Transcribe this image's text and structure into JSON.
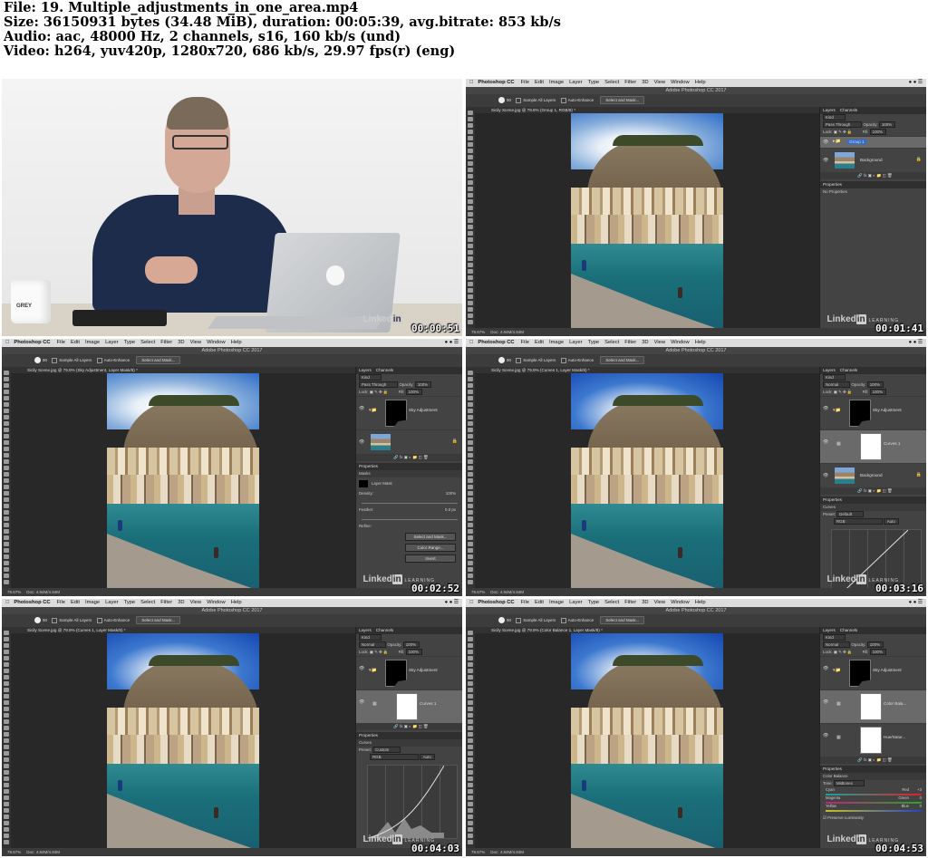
{
  "header": {
    "lines": [
      "File: 19. Multiple_adjustments_in_one_area.mp4",
      "Size: 36150931 bytes (34.48 MiB), duration: 00:05:39, avg.bitrate: 853 kb/s",
      "Audio: aac, 48000 Hz, 2 channels, s16, 160 kb/s (und)",
      "Video: h264, yuv420p, 1280x720, 686 kb/s, 29.97 fps(r) (eng)"
    ]
  },
  "watermark": {
    "brand": "Linked",
    "badge": "in",
    "sub": "LEARNING"
  },
  "mug_text": "GREY",
  "ps": {
    "app_menu": [
      "Photoshop CC",
      "File",
      "Edit",
      "Image",
      "Layer",
      "Type",
      "Select",
      "Filter",
      "3D",
      "View",
      "Window",
      "Help"
    ],
    "window_title": "Adobe Photoshop CC 2017",
    "options": {
      "sample_all": "Sample All Layers",
      "auto_enhance": "Auto-Enhance",
      "select_mask": "Select and Mask...",
      "brush_size": "90"
    },
    "panel_tabs": [
      "Layers",
      "Channels"
    ],
    "kind": "Kind",
    "opacity_label": "Opacity:",
    "fill_label": "Fill:",
    "lock_label": "Lock:",
    "pct": "100%",
    "properties": "Properties",
    "zoom": "79.67%",
    "doc": "Doc: 4.84M/4.84M"
  },
  "frames": [
    {
      "timestamp": "00:00:51",
      "kind": "video"
    },
    {
      "timestamp": "00:01:41",
      "doc_tab": "Sicily Scene.jpg @ 79.9% (Group 1, RGB/8) *",
      "blend": "Pass Through",
      "zoom": "79.67%",
      "layers": [
        {
          "name": "Group 1",
          "type": "group"
        },
        {
          "name": "Background",
          "type": "photo"
        }
      ],
      "props_title": "No Properties"
    },
    {
      "timestamp": "00:02:52",
      "doc_tab": "Sicily Scene.jpg @ 79.9% (Sky Adjustment, Layer Mask/8) *",
      "blend": "Pass Through",
      "zoom": "79.67%",
      "layers": [
        {
          "name": "Sky Adjustment",
          "type": "group"
        },
        {
          "name": "",
          "type": "photo"
        }
      ],
      "props_title": "Masks",
      "mask_label": "Layer Mask",
      "density": "Density:",
      "density_val": "100%",
      "feather": "Feather:",
      "feather_val": "0.0 px",
      "refine": "Refine:",
      "buttons": [
        "Select and Mask...",
        "Color Range...",
        "Invert"
      ]
    },
    {
      "timestamp": "00:03:16",
      "doc_tab": "Sicily Scene.jpg @ 79.9% (Curves 1, Layer Mask/8) *",
      "blend": "Normal",
      "zoom": "79.67%",
      "layers": [
        {
          "name": "Sky Adjustment",
          "type": "group"
        },
        {
          "name": "Curves 1",
          "type": "adj"
        },
        {
          "name": "Background",
          "type": "photo"
        }
      ],
      "props_title": "Curves",
      "preset_label": "Preset:",
      "preset": "Default",
      "channel": "RGB",
      "auto": "Auto"
    },
    {
      "timestamp": "00:04:03",
      "doc_tab": "Sicily Scene.jpg @ 79.9% (Curves 1, Layer Mask/8) *",
      "blend": "Normal",
      "zoom": "79.67%",
      "layers": [
        {
          "name": "Sky Adjustment",
          "type": "group"
        },
        {
          "name": "Curves 1",
          "type": "adj"
        }
      ],
      "props_title": "Curves",
      "preset_label": "Preset:",
      "preset": "Custom",
      "channel": "RGB",
      "auto": "Auto"
    },
    {
      "timestamp": "00:04:53",
      "doc_tab": "Sicily Scene.jpg @ 79.9% (Color Balance 1, Layer Mask/8) *",
      "blend": "Normal",
      "zoom": "79.67%",
      "layers": [
        {
          "name": "Sky Adjustment",
          "type": "group"
        },
        {
          "name": "Color Bala...",
          "type": "adj"
        },
        {
          "name": "Hue/Satur...",
          "type": "adj"
        }
      ],
      "props_title": "Color Balance",
      "tone_label": "Tone:",
      "tone": "Midtones",
      "bars": [
        {
          "left": "Cyan",
          "right": "Red",
          "value": "+3"
        },
        {
          "left": "Magenta",
          "right": "Green",
          "value": "0"
        },
        {
          "left": "Yellow",
          "right": "Blue",
          "value": "0"
        }
      ],
      "preserve": "Preserve Luminosity"
    }
  ]
}
